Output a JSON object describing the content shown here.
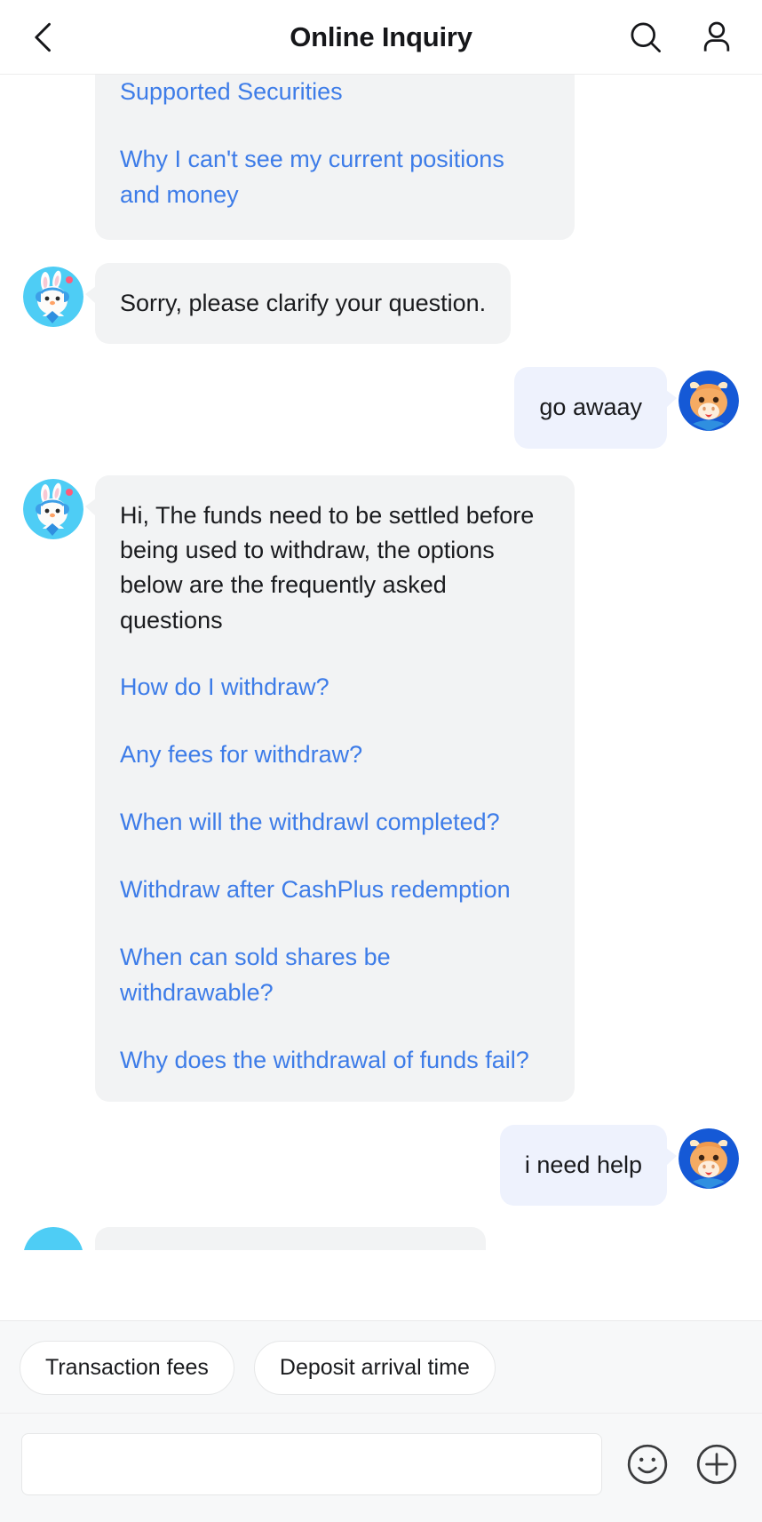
{
  "header": {
    "title": "Online Inquiry",
    "back_icon": "chevron-left-icon",
    "search_icon": "search-icon",
    "profile_icon": "person-icon"
  },
  "chat": {
    "messages": [
      {
        "sender": "bot",
        "clipped_top": true,
        "links": [
          "Supported Securities",
          "Why I can't see my current positions and money"
        ]
      },
      {
        "sender": "bot",
        "text": "Sorry, please clarify your question."
      },
      {
        "sender": "user",
        "text": "go awaay"
      },
      {
        "sender": "bot",
        "text": "Hi, The funds need to be settled before being used to withdraw, the options below are the frequently asked questions",
        "links": [
          "How do I withdraw?",
          "Any fees for withdraw?",
          "When will the withdrawl completed?",
          "Withdraw after CashPlus redemption",
          "When can sold shares be withdrawable?",
          "Why does the withdrawal of funds fail?"
        ]
      },
      {
        "sender": "user",
        "text": "i need help"
      }
    ]
  },
  "bottom": {
    "quick_replies": [
      "Transaction fees",
      "Deposit arrival time"
    ],
    "input_value": "",
    "input_placeholder": "",
    "emoji_icon": "smiley-face-icon",
    "plus_icon": "plus-circle-icon"
  },
  "colors": {
    "link_blue": "#3d7ce8",
    "bot_bubble": "#f2f3f4",
    "user_bubble": "#eef2fd",
    "bot_avatar_bg": "#4ecdf5",
    "user_avatar_bg": "#1559d6",
    "bull_orange": "#f3a85a",
    "text_dark": "#1a1b1e",
    "bottom_bg": "#f7f8f9"
  }
}
